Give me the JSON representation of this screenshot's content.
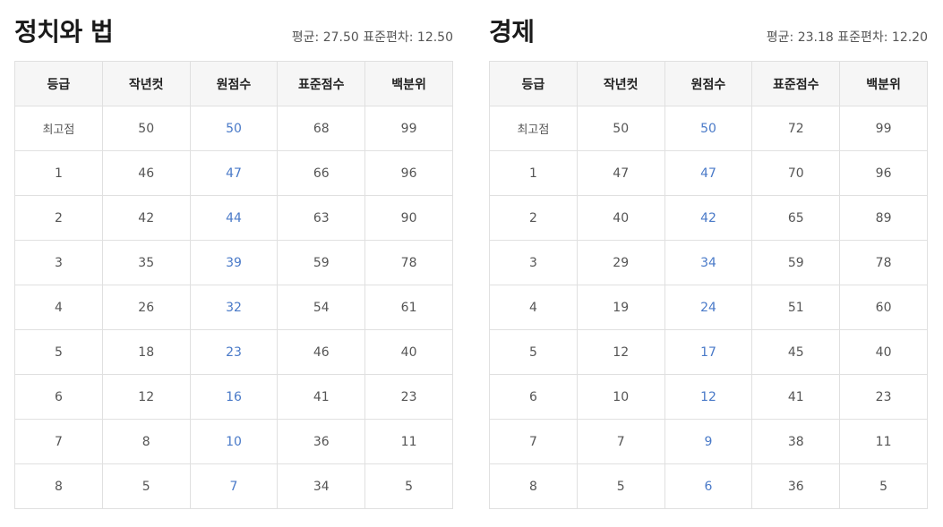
{
  "columns": [
    "등급",
    "작년컷",
    "원점수",
    "표준점수",
    "백분위"
  ],
  "panels": [
    {
      "title": "정치와 법",
      "stats": "평균: 27.50 표준편차: 12.50",
      "rows": [
        [
          "최고점",
          "50",
          "50",
          "68",
          "99"
        ],
        [
          "1",
          "46",
          "47",
          "66",
          "96"
        ],
        [
          "2",
          "42",
          "44",
          "63",
          "90"
        ],
        [
          "3",
          "35",
          "39",
          "59",
          "78"
        ],
        [
          "4",
          "26",
          "32",
          "54",
          "61"
        ],
        [
          "5",
          "18",
          "23",
          "46",
          "40"
        ],
        [
          "6",
          "12",
          "16",
          "41",
          "23"
        ],
        [
          "7",
          "8",
          "10",
          "36",
          "11"
        ],
        [
          "8",
          "5",
          "7",
          "34",
          "5"
        ]
      ]
    },
    {
      "title": "경제",
      "stats": "평균: 23.18 표준편차: 12.20",
      "rows": [
        [
          "최고점",
          "50",
          "50",
          "72",
          "99"
        ],
        [
          "1",
          "47",
          "47",
          "70",
          "96"
        ],
        [
          "2",
          "40",
          "42",
          "65",
          "89"
        ],
        [
          "3",
          "29",
          "34",
          "59",
          "78"
        ],
        [
          "4",
          "19",
          "24",
          "51",
          "60"
        ],
        [
          "5",
          "12",
          "17",
          "45",
          "40"
        ],
        [
          "6",
          "10",
          "12",
          "41",
          "23"
        ],
        [
          "7",
          "7",
          "9",
          "38",
          "11"
        ],
        [
          "8",
          "5",
          "6",
          "36",
          "5"
        ]
      ]
    }
  ],
  "colors": {
    "raw_score": "#4a7ac8",
    "header_bg": "#f6f6f6",
    "border": "#e0e0e0"
  }
}
